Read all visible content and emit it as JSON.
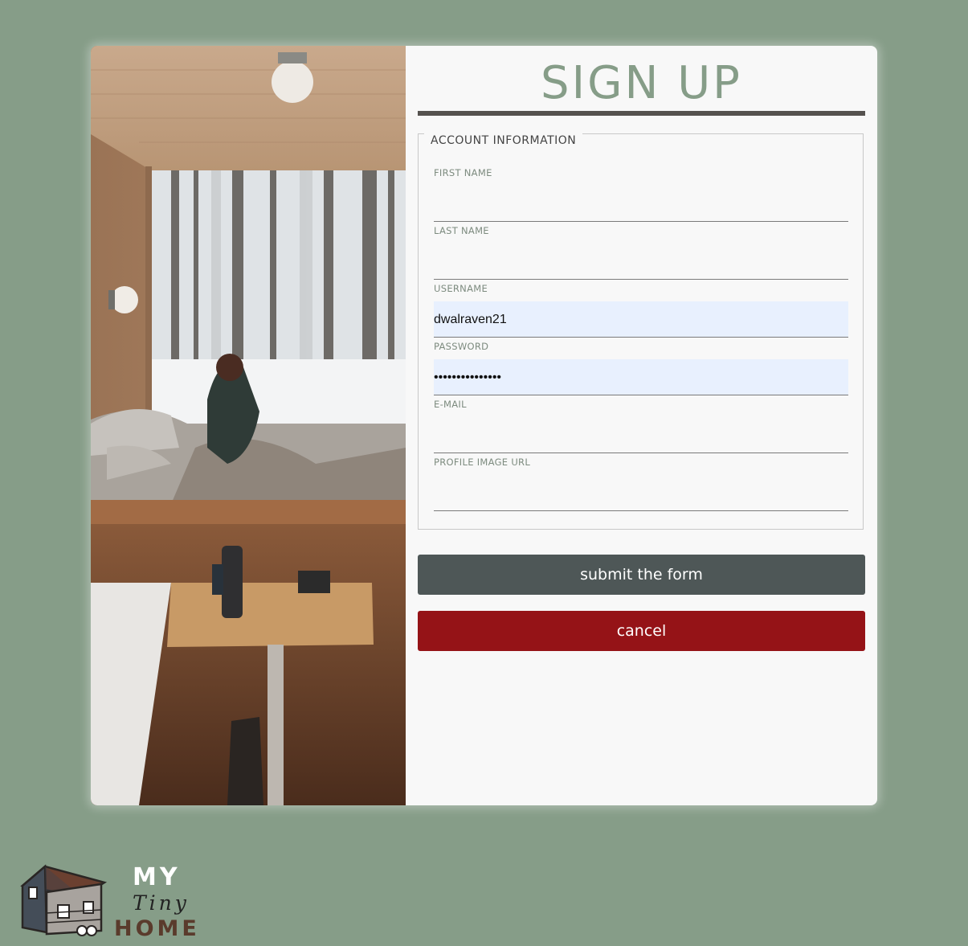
{
  "form": {
    "title": "SIGN UP",
    "legend": "ACCOUNT INFORMATION",
    "fields": [
      {
        "label": "FIRST NAME",
        "value": ""
      },
      {
        "label": "LAST NAME",
        "value": ""
      },
      {
        "label": "USERNAME",
        "value": "dwalraven21"
      },
      {
        "label": "PASSWORD",
        "value": "•••••••••••••••"
      },
      {
        "label": "E-MAIL",
        "value": ""
      },
      {
        "label": "PROFILE IMAGE URL",
        "value": ""
      }
    ],
    "submit_label": "submit the form",
    "cancel_label": "cancel"
  },
  "logo": {
    "line1": "MY",
    "line2": "Tiny",
    "line3": "HOME"
  },
  "colors": {
    "background": "#869d88",
    "title": "#869d88",
    "submit_button": "#4e5757",
    "cancel_button": "#951317",
    "autofill": "#e8f0fe"
  },
  "image": {
    "icon": "cabin-photo"
  }
}
